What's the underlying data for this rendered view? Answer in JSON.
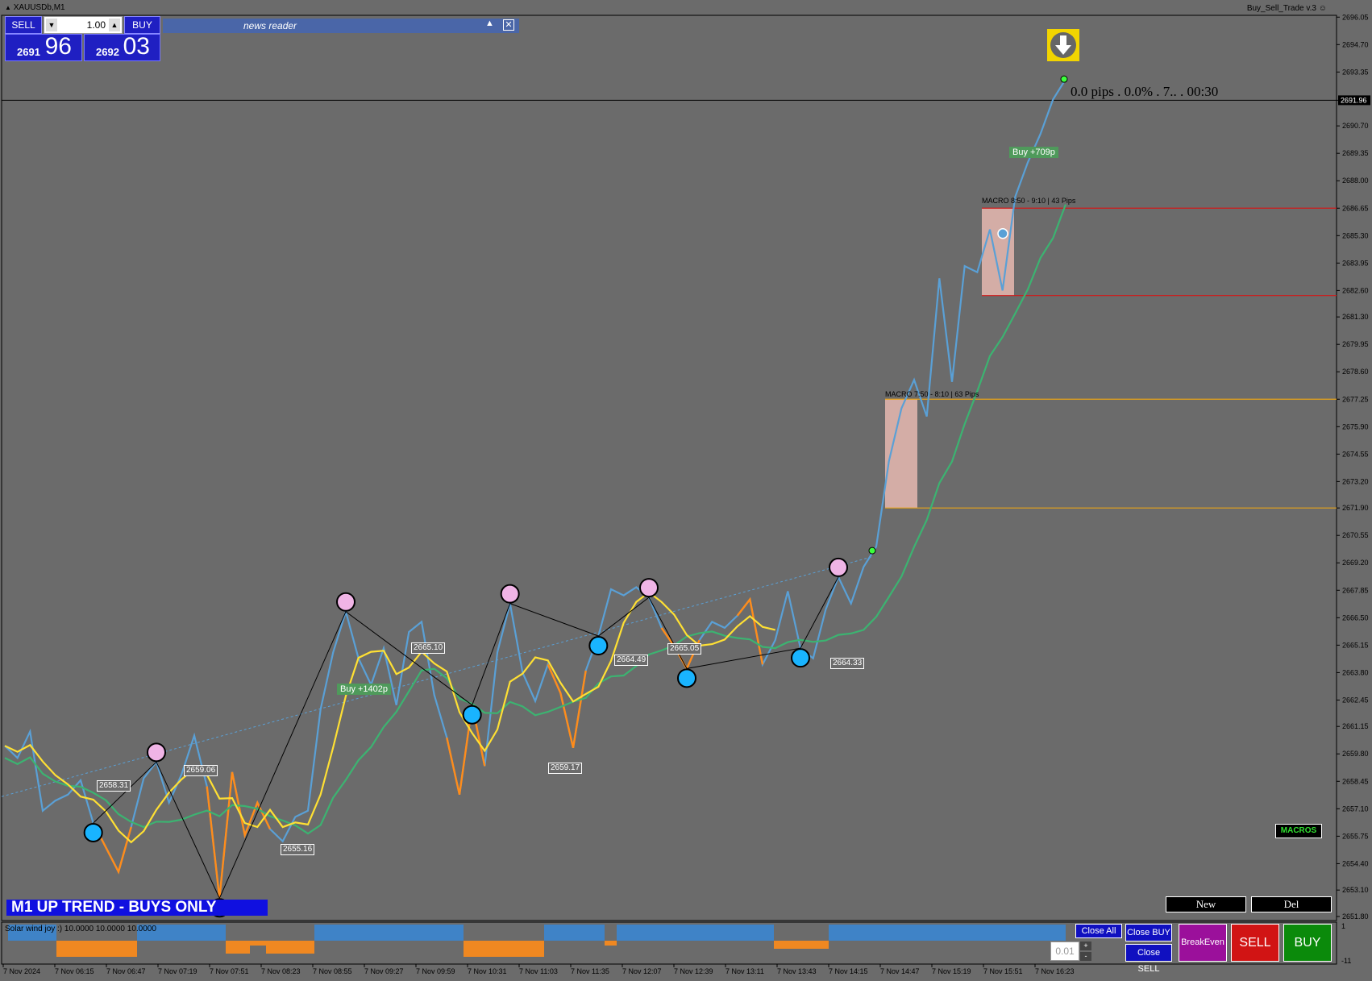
{
  "window": {
    "symbol_title": "XAUUSDb,M1",
    "ea_title": "Buy_Sell_Trade v.3"
  },
  "trade_panel": {
    "sell_label": "SELL",
    "buy_label": "BUY",
    "lot_value": "1.00",
    "sell_price_prefix": "2691",
    "sell_price_big": "96",
    "buy_price_prefix": "2692",
    "buy_price_big": "03"
  },
  "news_reader": {
    "title": "news reader"
  },
  "trend_banner": "M1  UP TREND - BUYS ONLY",
  "info_text": "0.0 pips . 0.0% . 7.. . 00:30",
  "trade_labels": [
    {
      "text": "Buy +1402p"
    },
    {
      "text": "Buy +709p"
    }
  ],
  "macro_labels": [
    {
      "text": "MACRO 7:50 - 8:10 | 63 Pips"
    },
    {
      "text": "MACRO 8:50 - 9:10 | 43 Pips"
    }
  ],
  "level_labels": [
    "2658.31",
    "2659.06",
    "2655.16",
    "2665.10",
    "2659.17",
    "2664.49",
    "2665.05",
    "2664.33"
  ],
  "buttons": {
    "macros": "MACROS",
    "new": "New",
    "del": "Del",
    "close_all": "Close All",
    "close_buy": "Close BUY",
    "close_sell": "Close SELL",
    "breakeven": "BreakEven",
    "sell": "SELL",
    "buy": "BUY",
    "lot_small": "0.01",
    "plus": "+",
    "minus": "-"
  },
  "indicator": {
    "label": "Solar wind joy :) 10.0000 10.0000 10.0000",
    "ticks": [
      "1",
      "-11"
    ]
  },
  "colors": {
    "background": "#6b6b6b",
    "price_line": "#5aa0d6",
    "bear_segment": "#ff8c1a",
    "moving_average": "#ffe033",
    "trend_ma": "#3cb371",
    "macro_box": "#e6b8b0",
    "red_line": "#d11a1a",
    "gold_line": "#e8a317",
    "banner": "#1010e0"
  },
  "chart_data": {
    "type": "line",
    "title": "XAUUSDb,M1",
    "ylim": [
      2651.6,
      2696.1
    ],
    "y_ticks": [
      "2696.05",
      "2694.70",
      "2693.35",
      "2691.96",
      "2690.70",
      "2689.35",
      "2688.00",
      "2686.65",
      "2685.30",
      "2683.95",
      "2682.60",
      "2681.30",
      "2679.95",
      "2678.60",
      "2677.25",
      "2675.90",
      "2674.55",
      "2673.20",
      "2671.90",
      "2670.55",
      "2669.20",
      "2667.85",
      "2666.50",
      "2665.15",
      "2663.80",
      "2662.45",
      "2661.15",
      "2659.80",
      "2658.45",
      "2657.10",
      "2655.75",
      "2654.40",
      "2653.10",
      "2651.80"
    ],
    "current_price": "2691.96",
    "x_ticks": [
      "7 Nov 2024",
      "7 Nov 06:15",
      "7 Nov 06:47",
      "7 Nov 07:19",
      "7 Nov 07:51",
      "7 Nov 08:23",
      "7 Nov 08:55",
      "7 Nov 09:27",
      "7 Nov 09:59",
      "7 Nov 10:31",
      "7 Nov 11:03",
      "7 Nov 11:35",
      "7 Nov 12:07",
      "7 Nov 12:39",
      "7 Nov 13:11",
      "7 Nov 13:43",
      "7 Nov 14:15",
      "7 Nov 14:47",
      "7 Nov 15:19",
      "7 Nov 15:51",
      "7 Nov 16:23"
    ],
    "series": [
      {
        "values": [
          2660.2,
          2659.6,
          2660.9,
          2657.0,
          2657.5,
          2657.8,
          2658.5,
          2656.4,
          2655.2,
          2654.0,
          2656.2,
          2658.6,
          2659.4,
          2657.4,
          2658.8,
          2660.7,
          2658.2,
          2652.7,
          2658.9,
          2655.8,
          2657.4,
          2656.1,
          2655.5,
          2656.7,
          2657.0,
          2662.0,
          2664.8,
          2666.8,
          2664.5,
          2663.2,
          2665.0,
          2662.2,
          2665.8,
          2666.3,
          2662.7,
          2660.6,
          2657.8,
          2662.2,
          2659.2,
          2664.8,
          2667.2,
          2663.8,
          2662.4,
          2664.2,
          2662.8,
          2660.1,
          2663.9,
          2665.6,
          2667.9,
          2667.6,
          2668.0,
          2667.5,
          2666.0,
          2665.1,
          2664.0,
          2665.4,
          2666.3,
          2666.0,
          2666.6,
          2667.4,
          2664.2,
          2665.4,
          2667.8,
          2665.0,
          2664.5,
          2666.9,
          2668.5,
          2667.2,
          2669.0,
          2670.0,
          2674.2,
          2676.8,
          2678.2,
          2676.4,
          2683.2,
          2678.1,
          2683.8,
          2683.5,
          2685.6,
          2682.6,
          2687.2,
          2688.9,
          2690.3,
          2692.0,
          2693.0
        ]
      }
    ]
  }
}
